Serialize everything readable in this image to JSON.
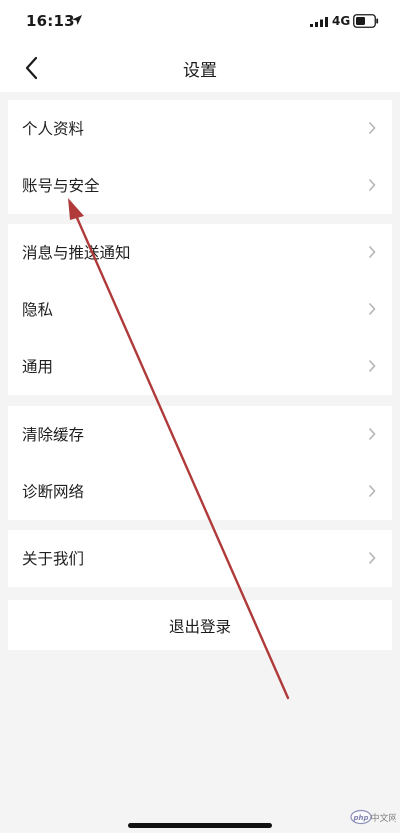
{
  "status_bar": {
    "time": "16:13",
    "network": "4G",
    "icons": [
      "location-arrow-icon",
      "signal-bars-icon",
      "battery-icon"
    ]
  },
  "nav": {
    "title": "设置",
    "back_icon": "chevron-left-icon"
  },
  "groups": [
    {
      "items": [
        {
          "label": "个人资料"
        },
        {
          "label": "账号与安全"
        }
      ]
    },
    {
      "items": [
        {
          "label": "消息与推送通知"
        },
        {
          "label": "隐私"
        },
        {
          "label": "通用"
        }
      ]
    },
    {
      "items": [
        {
          "label": "清除缓存"
        },
        {
          "label": "诊断网络"
        }
      ]
    },
    {
      "items": [
        {
          "label": "关于我们"
        }
      ]
    }
  ],
  "logout": {
    "label": "退出登录"
  },
  "annotation": {
    "color": "#b03a3a",
    "points_to": "账号与安全"
  },
  "watermark": {
    "logo": "php-logo",
    "text": "中文网"
  },
  "colors": {
    "background": "#f4f4f4",
    "card": "#ffffff",
    "chevron": "#b5b5b5",
    "text": "#1f1f1f"
  }
}
